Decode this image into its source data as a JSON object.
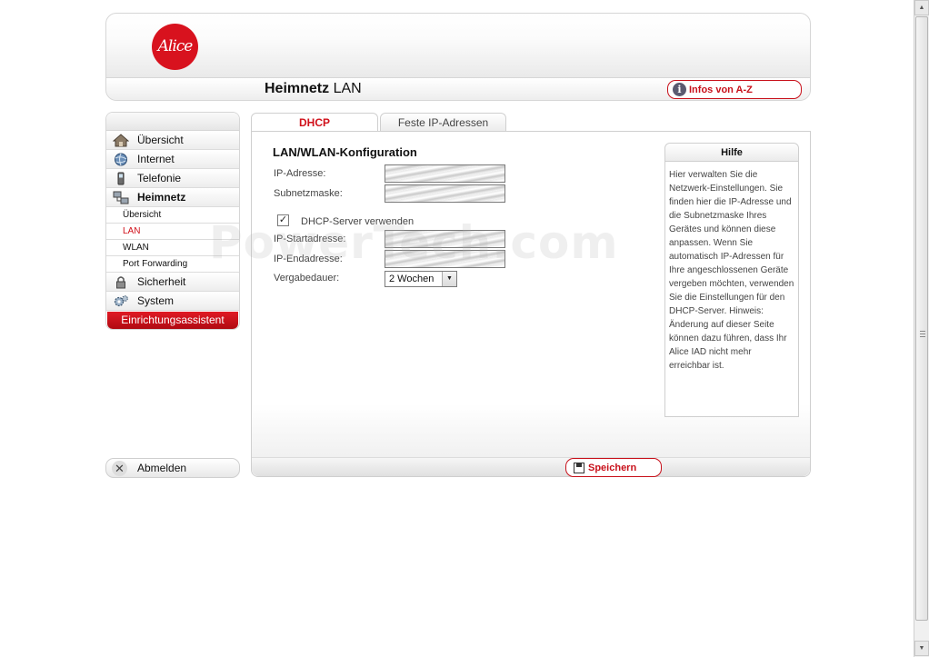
{
  "header": {
    "logo_text": "Alice",
    "title_bold": "Heimnetz",
    "title_rest": " LAN",
    "info_button_label": "Infos von A-Z"
  },
  "sidebar": {
    "items": [
      {
        "label": "Übersicht",
        "icon": "home-icon"
      },
      {
        "label": "Internet",
        "icon": "globe-icon"
      },
      {
        "label": "Telefonie",
        "icon": "phone-icon"
      },
      {
        "label": "Heimnetz",
        "icon": "network-icon",
        "active": true
      }
    ],
    "subitems": [
      {
        "label": "Übersicht"
      },
      {
        "label": "LAN",
        "current": true
      },
      {
        "label": "WLAN"
      },
      {
        "label": "Port Forwarding"
      }
    ],
    "items_after": [
      {
        "label": "Sicherheit",
        "icon": "lock-icon"
      },
      {
        "label": "System",
        "icon": "gear-icon"
      }
    ],
    "wizard_label": "Einrichtungsassistent",
    "logout_label": "Abmelden"
  },
  "tabs": [
    {
      "label": "DHCP",
      "active": true
    },
    {
      "label": "Feste IP-Adressen",
      "active": false
    }
  ],
  "form": {
    "section_title": "LAN/WLAN-Konfiguration",
    "ip_label": "IP-Adresse:",
    "subnet_label": "Subnetzmaske:",
    "dhcp_checkbox_label": "DHCP-Server verwenden",
    "dhcp_checked": true,
    "start_label": "IP-Startadresse:",
    "end_label": "IP-Endadresse:",
    "lease_label": "Vergabedauer:",
    "lease_value": "2 Wochen"
  },
  "help": {
    "title": "Hilfe",
    "text": "Hier verwalten Sie die Netzwerk-Einstellungen. Sie finden hier die IP-Adresse und die Subnetzmaske Ihres Gerätes und können diese anpassen. Wenn Sie automatisch IP-Adressen für Ihre angeschlossenen Geräte vergeben möchten, verwenden Sie die Einstellungen für den DHCP-Server. Hinweis: Änderung auf dieser Seite können dazu führen, dass Ihr Alice IAD nicht mehr erreichbar ist."
  },
  "footer": {
    "save_label": "Speichern"
  },
  "watermark": "PowerTech.com",
  "colors": {
    "brand_red": "#d0101a",
    "border": "#cfcfcf"
  }
}
